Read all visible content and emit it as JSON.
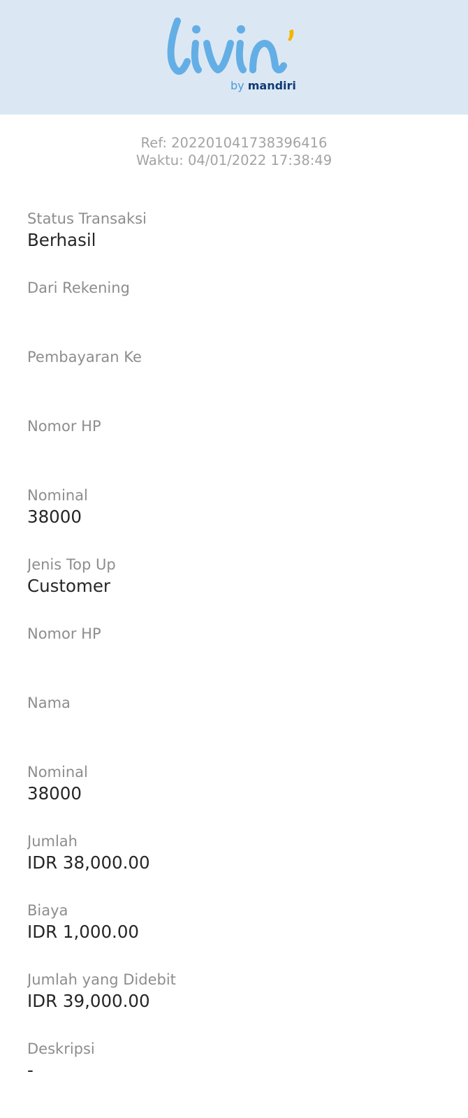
{
  "header": {
    "logo_text": "livin'",
    "logo_by": "by",
    "logo_brand": "mandiri",
    "colors": {
      "background": "#dbe8f3",
      "logo_blue": "#64aee6",
      "logo_accent": "#f5b400",
      "brand_navy": "#103a74"
    }
  },
  "meta": {
    "ref": "Ref: 202201041738396416",
    "time": "Waktu: 04/01/2022 17:38:49"
  },
  "fields": [
    {
      "label": "Status Transaksi",
      "value": "Berhasil"
    },
    {
      "label": "Dari Rekening",
      "value": ""
    },
    {
      "label": "Pembayaran Ke",
      "value": ""
    },
    {
      "label": "Nomor HP",
      "value": ""
    },
    {
      "label": "Nominal",
      "value": "38000"
    },
    {
      "label": "Jenis Top Up",
      "value": "Customer"
    },
    {
      "label": "Nomor HP",
      "value": ""
    },
    {
      "label": "Nama",
      "value": ""
    },
    {
      "label": "Nominal",
      "value": "38000"
    },
    {
      "label": "Jumlah",
      "value": "IDR 38,000.00"
    },
    {
      "label": "Biaya",
      "value": "IDR 1,000.00"
    },
    {
      "label": "Jumlah yang Didebit",
      "value": "IDR 39,000.00"
    },
    {
      "label": "Deskripsi",
      "value": "-"
    }
  ]
}
